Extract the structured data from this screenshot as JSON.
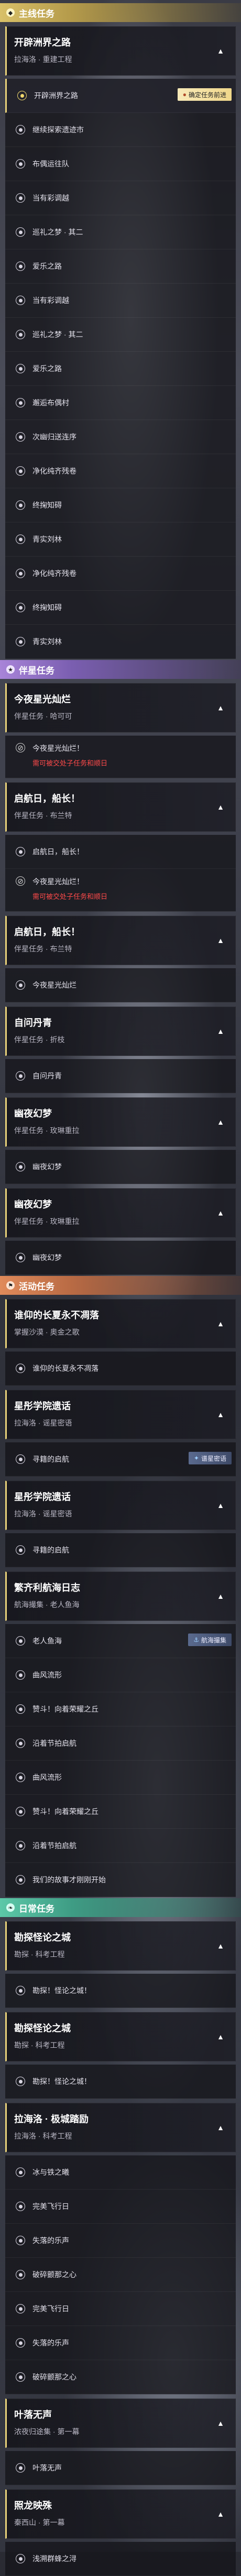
{
  "categories": {
    "main": {
      "label": "主线任务",
      "icon": "diamond-icon"
    },
    "companion": {
      "label": "伴星任务",
      "icon": "star-icon"
    },
    "event": {
      "label": "活动任务",
      "icon": "flag-icon"
    },
    "daily": {
      "label": "日常任务",
      "icon": "leaf-icon"
    }
  },
  "quests": [
    {
      "title": "开辟洲界之路",
      "subtitle": "拉海洛 · 重建工程",
      "expanded": true
    },
    {
      "title": "今夜星光灿烂",
      "subtitle": "伴星任务 · 哈可可",
      "expanded": true
    },
    {
      "title": "启航日，船长！",
      "subtitle": "伴星任务 · 布兰特",
      "expanded": true
    },
    {
      "title": "启航日，船长！",
      "subtitle": "伴星任务 · 布兰特",
      "expanded": true
    },
    {
      "title": "自问丹青",
      "subtitle": "伴星任务 · 折枝",
      "expanded": true
    },
    {
      "title": "幽夜幻梦",
      "subtitle": "伴星任务 · 玫琳重拉",
      "expanded": true
    },
    {
      "title": "幽夜幻梦",
      "subtitle": "伴星任务 · 玫琳重拉",
      "expanded": true
    },
    {
      "title": "谁仰的长夏永不凋落",
      "subtitle": "掌握沙漠 · 奥金之歌",
      "expanded": true
    },
    {
      "title": "星彤学院遗话",
      "subtitle": "拉海洛 · 谣星密语",
      "expanded": true
    },
    {
      "title": "星彤学院遗话",
      "subtitle": "拉海洛 · 谣星密语",
      "expanded": true
    },
    {
      "title": "繁齐利航海日志",
      "subtitle": "航海撮集 · 老人鱼海",
      "expanded": true
    },
    {
      "title": "勘探怪论之城",
      "subtitle": "勘探 · 科考工程",
      "expanded": true
    },
    {
      "title": "勘探怪论之城",
      "subtitle": "勘探 · 科考工程",
      "expanded": true
    },
    {
      "title": "拉海洛 · 极城踏励",
      "subtitle": "拉海洛 · 科考工程",
      "expanded": true
    },
    {
      "title": "叶落无声",
      "subtitle": "浓夜归途集 · 第一幕",
      "expanded": true
    },
    {
      "title": "照龙映殊",
      "subtitle": "秦西山 · 第一幕",
      "expanded": true
    }
  ],
  "steps": {
    "s01": "开辟洲界之路",
    "s02": "继续探索遗迹市",
    "s03": "布偶运往队",
    "s04": "当有彩调越",
    "s05": "巡礼之梦 · 其二",
    "s06": "爱乐之路",
    "s07": "当有彩调越",
    "s08": "巡礼之梦 · 其二",
    "s09": "爱乐之路",
    "s10": "邂逅布偶村",
    "s11": "次幽归送连序",
    "s12": "净化纯齐残卷",
    "s13": "终掬知碍",
    "s14": "青实刘林",
    "s15": "净化纯齐残卷",
    "s16": "终掬知碍",
    "s17": "青实刘林",
    "s18": "今夜星光灿烂！",
    "s19": "今夜星光灿烂！",
    "s20": "启航日，船长！",
    "s21": "自问丹青",
    "s22": "幽夜幻梦",
    "s23": "幽夜幻梦",
    "s24": "谁仰的长夏永不凋落",
    "s25": "寻籍的启航",
    "s26": "寻籍的启航",
    "s27": "老人鱼海",
    "s28": "曲风流形",
    "s29": "赞斗！向着荣耀之丘",
    "s30": "沿着节拍启航",
    "s31": "曲风流形",
    "s32": "赞斗！向着荣耀之丘",
    "s33": "沿着节拍启航",
    "s34": "我们的故事才刚刚开始",
    "s35": "勘探！怪论之城！",
    "s36": "勘探！怪论之城！",
    "s37": "冰与铁之曦",
    "s38": "完美飞行日",
    "s39": "失落的乐声",
    "s40": "破碎颤那之心",
    "s41": "完美飞行日",
    "s42": "失落的乐声",
    "s43": "破碎颤那之心",
    "s44": "叶落无声",
    "s45": "浅溯群蜂之浔"
  },
  "blocked": {
    "b1": {
      "label": "今夜星光灿烂",
      "warning": "需可被交处子任务和顺日"
    },
    "b2": {
      "label": "今夜星光灿烂",
      "warning": "需可被交处子任务和顺日"
    }
  },
  "tags": {
    "track": "确定任务前进",
    "wander": "谱星密语",
    "nav": "航海撮集"
  },
  "colors": {
    "main": "#d8c068",
    "companion": "#a884d8",
    "event": "#e08a5a",
    "daily": "#5cc8a8",
    "warning": "#ff4a4a"
  }
}
